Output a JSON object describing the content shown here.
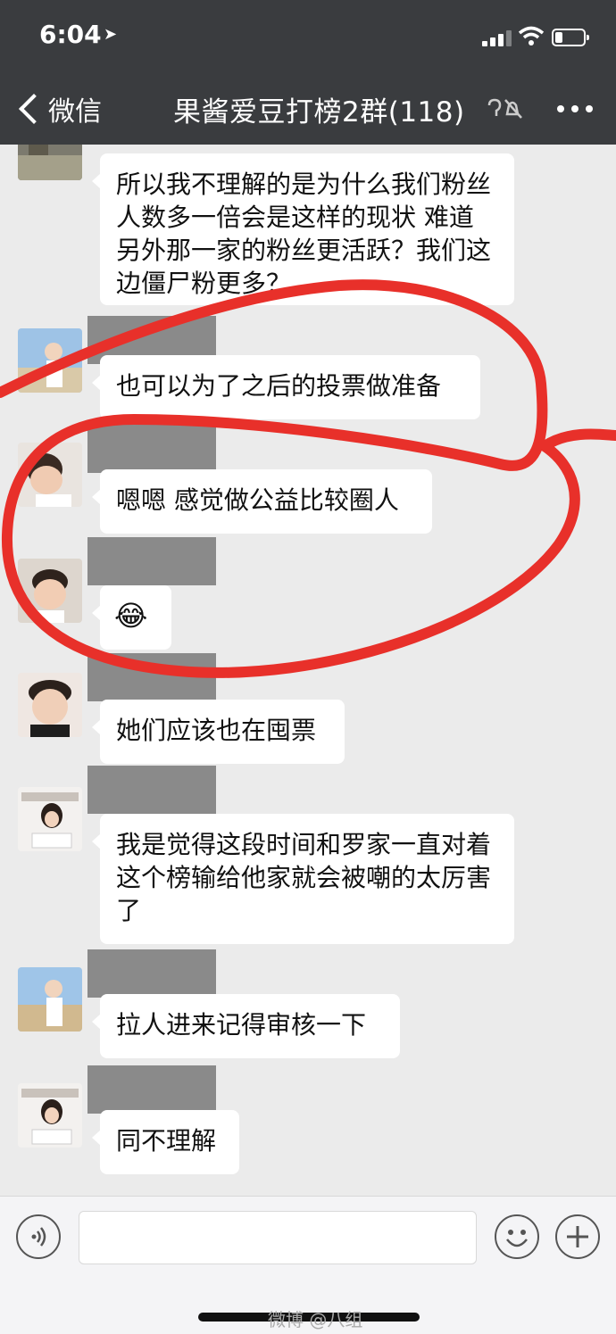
{
  "status": {
    "time": "6:04"
  },
  "nav": {
    "back_label": "微信",
    "title": "果酱爱豆打榜2群(118)"
  },
  "messages": [
    {
      "text": "所以我不理解的是为什么我们粉丝人数多一倍会是这样的现状 难道另外那一家的粉丝更活跃？我们这边僵尸粉更多？"
    },
    {
      "text": "也可以为了之后的投票做准备"
    },
    {
      "text": "嗯嗯 感觉做公益比较圈人"
    },
    {
      "text": "😂"
    },
    {
      "text": "她们应该也在囤票"
    },
    {
      "text": "我是觉得这段时间和罗家一直对着 这个榜输给他家就会被嘲的太厉害了"
    },
    {
      "text": "拉人进来记得审核一下"
    },
    {
      "text": "同不理解"
    }
  ],
  "watermark": "微博 @八组",
  "colors": {
    "header": "#3a3c3f",
    "background": "#ebebeb",
    "bubble": "#ffffff",
    "annotation": "#e8302a",
    "name_mask": "#8a8a8a"
  }
}
